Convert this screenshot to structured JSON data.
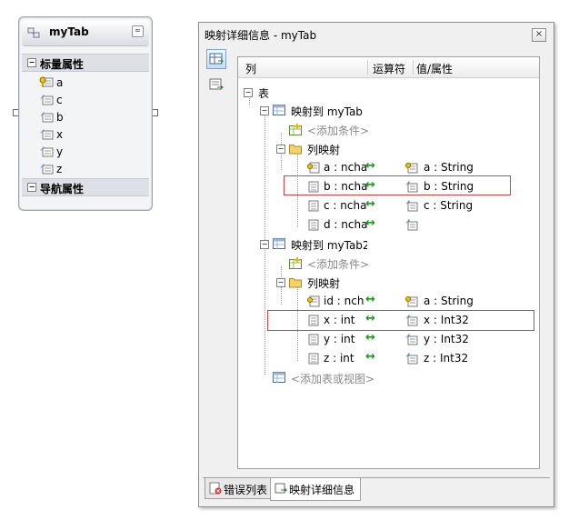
{
  "entity": {
    "title": "myTab",
    "sections": {
      "scalar": "标量属性",
      "nav": "导航属性"
    },
    "properties": [
      {
        "name": "a",
        "key": true
      },
      {
        "name": "c",
        "key": false
      },
      {
        "name": "b",
        "key": false
      },
      {
        "name": "x",
        "key": false
      },
      {
        "name": "y",
        "key": false
      },
      {
        "name": "z",
        "key": false
      }
    ]
  },
  "mapping_window": {
    "title": "映射详细信息 - myTab",
    "close_glyph": "×",
    "columns": {
      "col": "列",
      "op": "运算符",
      "val": "值/属性"
    },
    "root": "表",
    "table1": {
      "label": "映射到 myTab",
      "add_condition": "<添加条件>",
      "column_mappings": "列映射",
      "rows": [
        {
          "col": "a : ncha",
          "val": "a : String"
        },
        {
          "col": "b : ncha",
          "val": "b : String"
        },
        {
          "col": "c : ncha",
          "val": "c : String"
        },
        {
          "col": "d : ncha",
          "val": ""
        }
      ]
    },
    "table2": {
      "label": "映射到 myTab2",
      "add_condition": "<添加条件>",
      "column_mappings": "列映射",
      "rows": [
        {
          "col": "id : nch",
          "val": "a : String"
        },
        {
          "col": "x : int",
          "val": "x : Int32"
        },
        {
          "col": "y : int",
          "val": "y : Int32"
        },
        {
          "col": "z : int",
          "val": "z : Int32"
        }
      ]
    },
    "arrow_glyph": "↔",
    "add_table": "<添加表或视图>",
    "tabs": {
      "errors": "错误列表",
      "mapping": "映射详细信息"
    }
  },
  "colors": {
    "arrow": "#1a9a1a",
    "highlight": "#d94040",
    "muted": "#8a8a8a"
  }
}
